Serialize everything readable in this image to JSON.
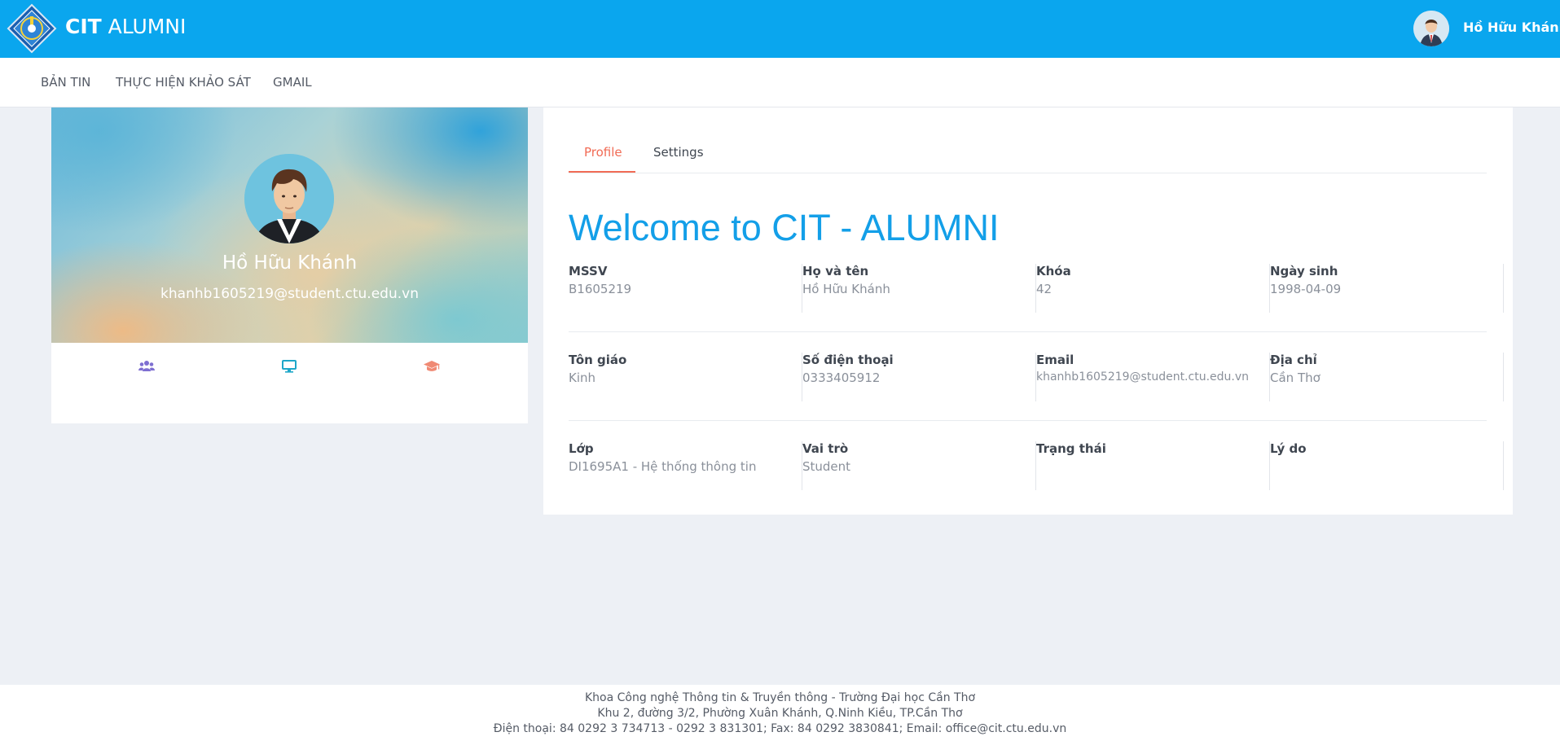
{
  "header": {
    "brand_bold": "CIT",
    "brand_light": "ALUMNI",
    "user_name": "Hồ Hữu Khánh"
  },
  "nav": {
    "items": [
      "BẢN TIN",
      "THỰC HIỆN KHẢO SÁT",
      "GMAIL"
    ]
  },
  "profile_card": {
    "name": "Hồ Hữu Khánh",
    "email": "khanhb1605219@student.ctu.edu.vn",
    "icons": [
      {
        "name": "users-icon",
        "color": "#7e6fd1"
      },
      {
        "name": "desktop-icon",
        "color": "#1ea7c9"
      },
      {
        "name": "graduation-cap-icon",
        "color": "#f08a74"
      }
    ]
  },
  "tabs": {
    "profile": "Profile",
    "settings": "Settings",
    "active": "Profile"
  },
  "welcome": "Welcome to CIT - ALUMNI",
  "fields": {
    "row1": [
      {
        "label": "MSSV",
        "value": "B1605219"
      },
      {
        "label": "Họ và tên",
        "value": "Hồ Hữu Khánh"
      },
      {
        "label": "Khóa",
        "value": "42"
      },
      {
        "label": "Ngày sinh",
        "value": "1998-04-09"
      }
    ],
    "row2": [
      {
        "label": "Tôn giáo",
        "value": "Kinh"
      },
      {
        "label": "Số điện thoại",
        "value": "0333405912"
      },
      {
        "label": "Email",
        "value": "khanhb1605219@student.ctu.edu.vn"
      },
      {
        "label": "Địa chỉ",
        "value": "Cần Thơ"
      }
    ],
    "row3": [
      {
        "label": "Lớp",
        "value": "DI1695A1 - Hệ thống thông tin"
      },
      {
        "label": "Vai trò",
        "value": "Student"
      },
      {
        "label": "Trạng thái",
        "value": ""
      },
      {
        "label": "Lý do",
        "value": ""
      }
    ]
  },
  "footer": {
    "line1": "Khoa Công nghệ Thông tin & Truyền thông - Trường Đại học Cần Thơ",
    "line2": "Khu 2, đường 3/2, Phường Xuân Khánh, Q.Ninh Kiều, TP.Cần Thơ",
    "line3": "Điện thoại: 84 0292 3 734713 - 0292 3 831301; Fax: 84 0292 3830841; Email: office@cit.ctu.edu.vn"
  },
  "colors": {
    "header_bg": "#0aa6ee",
    "accent_tab": "#f16b55",
    "welcome_text": "#139fe8",
    "page_bg": "#edf0f5"
  }
}
